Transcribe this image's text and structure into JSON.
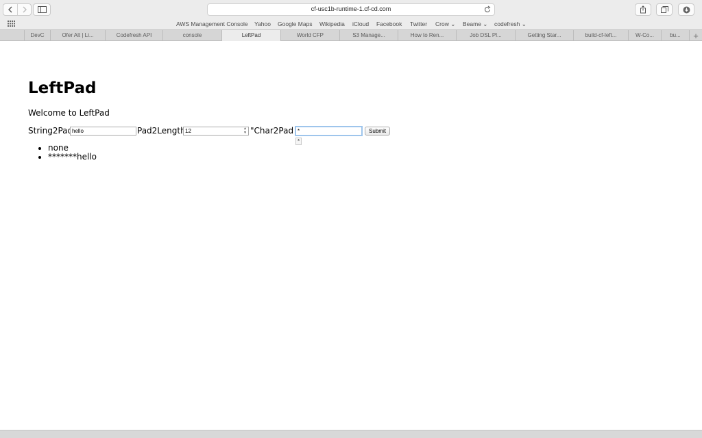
{
  "browser": {
    "url": "cf-usc1b-runtime-1.cf-cd.com",
    "favorites": [
      {
        "label": "AWS Management Console"
      },
      {
        "label": "Yahoo"
      },
      {
        "label": "Google Maps"
      },
      {
        "label": "Wikipedia"
      },
      {
        "label": "iCloud"
      },
      {
        "label": "Facebook"
      },
      {
        "label": "Twitter"
      },
      {
        "label": "Crow ⌄"
      },
      {
        "label": "Beame ⌄"
      },
      {
        "label": "codefresh ⌄"
      }
    ],
    "tabs": [
      {
        "label": ""
      },
      {
        "label": "DevC"
      },
      {
        "label": "Ofer Alt | Li..."
      },
      {
        "label": "Codefresh API"
      },
      {
        "label": "console"
      },
      {
        "label": "LeftPad"
      },
      {
        "label": "World CFP"
      },
      {
        "label": "S3 Manage..."
      },
      {
        "label": "How to Ren..."
      },
      {
        "label": "Job DSL Pl..."
      },
      {
        "label": "Getting Star..."
      },
      {
        "label": "build-cf-left..."
      },
      {
        "label": "W-Co..."
      },
      {
        "label": "bu..."
      }
    ],
    "new_tab_label": "+"
  },
  "page": {
    "title": "LeftPad",
    "welcome": "Welcome to LeftPad",
    "form": {
      "string_label": "String2Pad",
      "string_value": "hello",
      "length_label": "Pad2Length",
      "length_value": "12",
      "char_label": "\"Char2Pad \"",
      "char_value": "*",
      "autocomplete_value": "*",
      "submit_label": "Submit"
    },
    "results": [
      "none",
      "*******hello"
    ]
  }
}
